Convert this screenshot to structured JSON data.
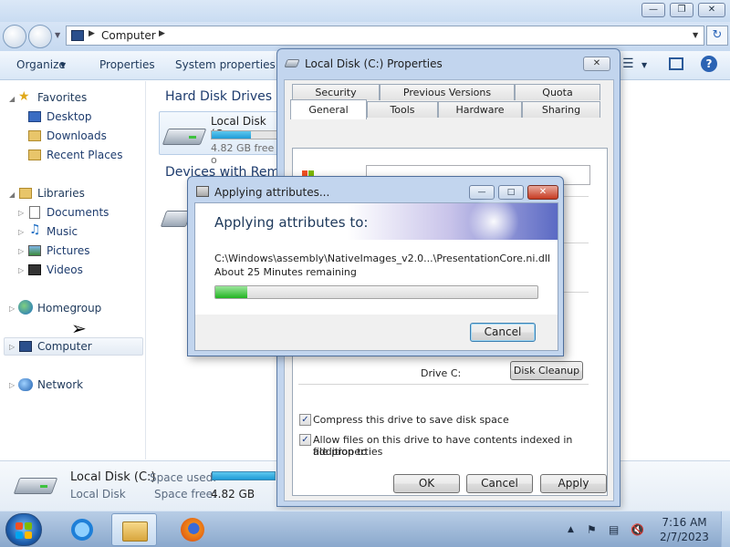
{
  "explorer": {
    "address": "Computer",
    "toolbar": {
      "organize": "Organize",
      "properties": "Properties",
      "system_properties": "System properties"
    },
    "nav": {
      "favorites": "Favorites",
      "desktop": "Desktop",
      "downloads": "Downloads",
      "recent_places": "Recent Places",
      "libraries": "Libraries",
      "documents": "Documents",
      "music": "Music",
      "pictures": "Pictures",
      "videos": "Videos",
      "homegroup": "Homegroup",
      "computer": "Computer",
      "network": "Network"
    },
    "content": {
      "hdd_header": "Hard Disk Drives (1",
      "drive_name": "Local Disk (C:",
      "drive_free": "4.82 GB free o",
      "devices_header": "Devices with Remo",
      "drive_fill_fraction": 0.55
    },
    "details": {
      "name": "Local Disk (C:)",
      "type": "Local Disk",
      "space_used_label": "Space used:",
      "space_free_label": "Space free:",
      "space_free_value": "4.82 GB"
    }
  },
  "properties": {
    "title": "Local Disk (C:) Properties",
    "tabs_row1": [
      "Security",
      "Previous Versions",
      "Quota"
    ],
    "tabs_row2": [
      "General",
      "Tools",
      "Hardware",
      "Sharing"
    ],
    "drive_label": "Drive C:",
    "disk_cleanup": "Disk Cleanup",
    "compress_label": "Compress this drive to save disk space",
    "compress_checked": true,
    "index_label_line1": "Allow files on this drive to have contents indexed in addition to",
    "index_label_line2": "file properties",
    "index_checked": true,
    "ok": "OK",
    "cancel": "Cancel",
    "apply": "Apply"
  },
  "apply_dialog": {
    "title": "Applying attributes...",
    "heading": "Applying attributes to:",
    "path": "C:\\Windows\\assembly\\NativeImages_v2.0...\\PresentationCore.ni.dll",
    "remaining": "About 25 Minutes remaining",
    "progress_fraction": 0.1,
    "cancel": "Cancel"
  },
  "taskbar": {
    "time": "7:16 AM",
    "date": "2/7/2023"
  },
  "colors": {
    "accent": "#1e395b",
    "progress": "#22b422",
    "drive_bar": "#1e9bd6"
  }
}
